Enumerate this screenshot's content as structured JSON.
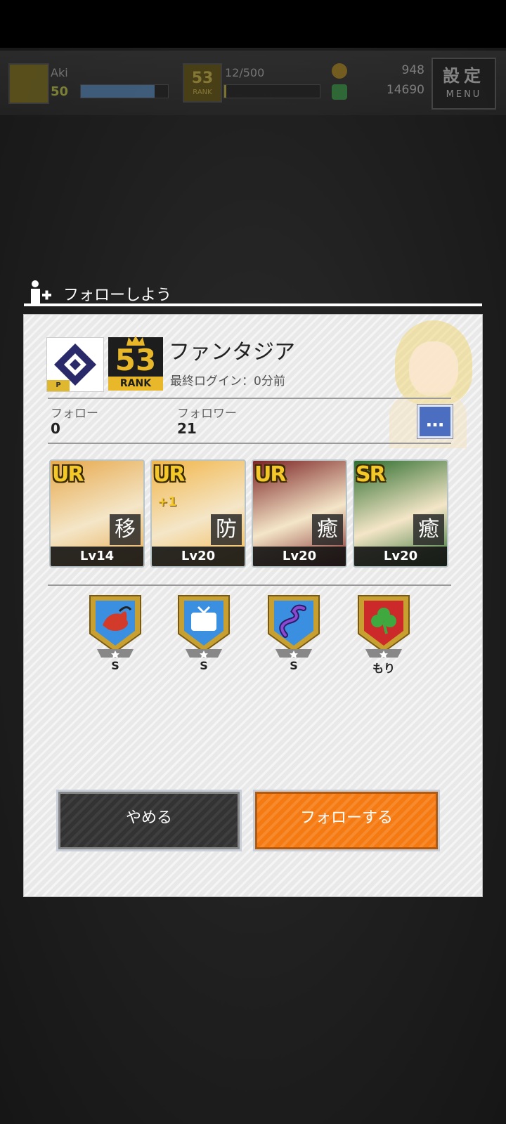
{
  "header": {
    "player_name": "Aki",
    "player_level": "50",
    "xp_progress": 0.85,
    "rank": "53",
    "rank_label": "RANK",
    "exp_text": "12/500",
    "exp_progress": 0.02,
    "coins": "948",
    "gems": "14690",
    "menu_top": "設定",
    "menu_bottom": "MENU"
  },
  "dialog": {
    "title": "フォローしよう",
    "profile": {
      "badge_text": "P",
      "rank": "53",
      "rank_label": "RANK",
      "name": "ファンタジア",
      "last_login": "最終ログイン：0分前",
      "follow_label": "フォロー",
      "follow_count": "0",
      "follower_label": "フォロワー",
      "follower_count": "21",
      "more_label": "…"
    },
    "cards": [
      {
        "rarity": "UR",
        "plus": "",
        "role": "移",
        "level": "Lv14",
        "color": "#e7a94c"
      },
      {
        "rarity": "UR",
        "plus": "+1",
        "role": "防",
        "level": "Lv20",
        "color": "#f2b64a"
      },
      {
        "rarity": "UR",
        "plus": "",
        "role": "癒",
        "level": "Lv20",
        "color": "#7c2324"
      },
      {
        "rarity": "SR",
        "plus": "",
        "role": "癒",
        "level": "Lv20",
        "color": "#2e6d2e"
      }
    ],
    "badges": [
      {
        "icon": "dragon-icon",
        "label": "S",
        "color": "#3b8fe0"
      },
      {
        "icon": "tv-icon",
        "label": "S",
        "color": "#3b8fe0"
      },
      {
        "icon": "serpent-icon",
        "label": "S",
        "color": "#3b8fe0"
      },
      {
        "icon": "clover-icon",
        "label": "もり",
        "color": "#cc2a2a"
      }
    ],
    "buttons": {
      "cancel": "やめる",
      "follow": "フォローする"
    }
  },
  "colors": {
    "accent_orange": "#f57a12",
    "rank_gold": "#e8b72a",
    "more_blue": "#4c6ec1"
  }
}
